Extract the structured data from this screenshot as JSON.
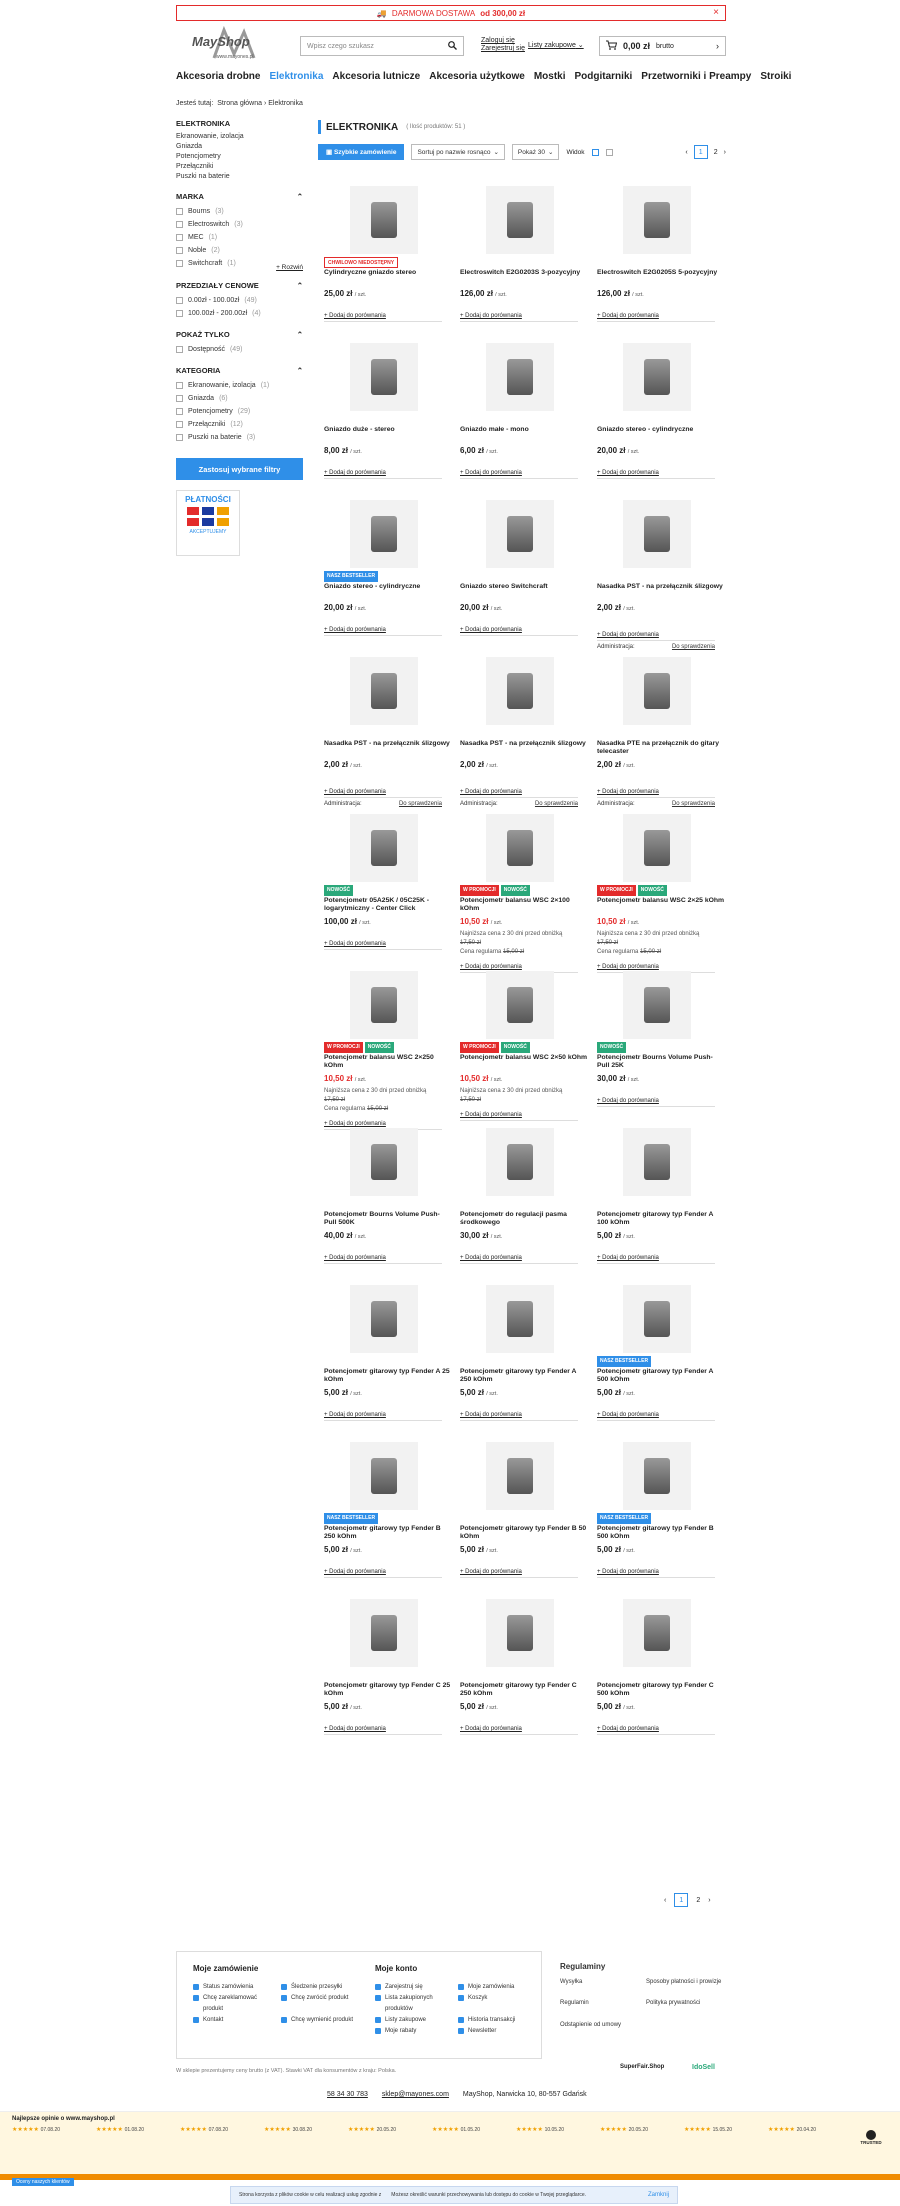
{
  "banner": {
    "text": "DARMOWA DOSTAWA",
    "amount": "od 300,00 zł"
  },
  "logo": {
    "name": "MayShop",
    "sub": "www.mayones.pl"
  },
  "search": {
    "placeholder": "Wpisz czego szukasz"
  },
  "account": {
    "login": "Zaloguj się",
    "register": "Zarejestruj się",
    "lists": "Listy zakupowe"
  },
  "cart": {
    "amount": "0,00 zł",
    "suffix": "brutto"
  },
  "nav": [
    "Akcesoria drobne",
    "Elektronika",
    "Akcesoria lutnicze",
    "Akcesoria użytkowe",
    "Mostki",
    "Podgitarniki",
    "Przetworniki i Preampy",
    "Stroiki"
  ],
  "breadcrumb": {
    "label": "Jesteś tutaj:",
    "home": "Strona główna",
    "current": "Elektronika"
  },
  "sidebar": {
    "cat_title": "ELEKTRONIKA",
    "cats": [
      "Ekranowanie, izolacja",
      "Gniazda",
      "Potencjometry",
      "Przełączniki",
      "Puszki na baterie"
    ],
    "brand_title": "MARKA",
    "brands": [
      {
        "n": "Bourns",
        "c": "(3)"
      },
      {
        "n": "Electroswitch",
        "c": "(3)"
      },
      {
        "n": "MEC",
        "c": "(1)"
      },
      {
        "n": "Noble",
        "c": "(2)"
      },
      {
        "n": "Switchcraft",
        "c": "(1)"
      }
    ],
    "expand": "+ Rozwiń",
    "price_title": "PRZEDZIAŁY CENOWE",
    "prices": [
      {
        "n": "0.00zł - 100.00zł",
        "c": "(49)"
      },
      {
        "n": "100.00zł - 200.00zł",
        "c": "(4)"
      }
    ],
    "show_title": "POKAŻ TYLKO",
    "shows": [
      {
        "n": "Dostępność",
        "c": "(49)"
      }
    ],
    "kat_title": "KATEGORIA",
    "kats": [
      {
        "n": "Ekranowanie, izolacja",
        "c": "(1)"
      },
      {
        "n": "Gniazda",
        "c": "(6)"
      },
      {
        "n": "Potencjometry",
        "c": "(29)"
      },
      {
        "n": "Przełączniki",
        "c": "(12)"
      },
      {
        "n": "Puszki na baterie",
        "c": "(3)"
      }
    ],
    "apply": "Zastosuj wybrane filtry",
    "payu_title": "PŁATNOŚCI",
    "payu_sub": "AKCEPTUJEMY"
  },
  "listing": {
    "title": "ELEKTRONIKA",
    "count": "( Ilość produktów: 51 )",
    "quick": "Szybkie zamówienie",
    "sort": "Sortuj po nazwie rosnąco",
    "perpage": "Pokaż 30",
    "view": "Widok"
  },
  "pager": {
    "prev": "‹",
    "p1": "1",
    "p2": "2",
    "next": "›"
  },
  "compare": "+ Dodaj do porównania",
  "admin": {
    "label": "Administracja:",
    "action": "Do sprawdzenia"
  },
  "price_unit": "/ szt.",
  "low_label": "Najniższa cena z 30 dni przed obniżką",
  "regular_label": "Cena regularna",
  "products": [
    {
      "name": "Cylindryczne gniazdo stereo",
      "price": "25,00 zł",
      "badges": [
        {
          "t": "CHWILOWO NIEDOSTĘPNY",
          "c": "redo"
        }
      ]
    },
    {
      "name": "Electroswitch E2G0203S 3-pozycyjny",
      "price": "126,00 zł",
      "badges": []
    },
    {
      "name": "Electroswitch E2G0205S 5-pozycyjny",
      "price": "126,00 zł",
      "badges": []
    },
    {
      "name": "Gniazdo duże - stereo",
      "price": "8,00 zł",
      "badges": []
    },
    {
      "name": "Gniazdo małe - mono",
      "price": "6,00 zł",
      "badges": []
    },
    {
      "name": "Gniazdo stereo - cylindryczne",
      "price": "20,00 zł",
      "badges": []
    },
    {
      "name": "Gniazdo stereo - cylindryczne",
      "price": "20,00 zł",
      "badges": [
        {
          "t": "NASZ BESTSELLER",
          "c": "blue"
        }
      ]
    },
    {
      "name": "Gniazdo stereo Switchcraft",
      "price": "20,00 zł",
      "badges": []
    },
    {
      "name": "Nasadka PST - na przełącznik ślizgowy",
      "price": "2,00 zł",
      "badges": [],
      "admin": true
    },
    {
      "name": "Nasadka PST - na przełącznik ślizgowy",
      "price": "2,00 zł",
      "badges": [],
      "admin": true
    },
    {
      "name": "Nasadka PST - na przełącznik ślizgowy",
      "price": "2,00 zł",
      "badges": [],
      "admin": true
    },
    {
      "name": "Nasadka PTE na przełącznik do gitary telecaster",
      "price": "2,00 zł",
      "badges": [],
      "admin": true
    },
    {
      "name": "Potencjometr 05A25K / 05C25K - logarytmiczny - Center Click",
      "price": "100,00 zł",
      "badges": [
        {
          "t": "NOWOŚĆ",
          "c": "green"
        }
      ]
    },
    {
      "name": "Potencjometr balansu WSC 2×100 kOhm",
      "price": "10,50 zł",
      "red": true,
      "low": "17,50 zł",
      "regular": "15,00 zł",
      "badges": [
        {
          "t": "W PROMOCJI",
          "c": "red"
        },
        {
          "t": "NOWOŚĆ",
          "c": "green"
        }
      ]
    },
    {
      "name": "Potencjometr balansu WSC 2×25 kOhm",
      "price": "10,50 zł",
      "red": true,
      "low": "17,50 zł",
      "regular": "15,00 zł",
      "badges": [
        {
          "t": "W PROMOCJI",
          "c": "red"
        },
        {
          "t": "NOWOŚĆ",
          "c": "green"
        }
      ]
    },
    {
      "name": "Potencjometr balansu WSC 2×250 kOhm",
      "price": "10,50 zł",
      "red": true,
      "low": "17,50 zł",
      "regular": "15,00 zł",
      "badges": [
        {
          "t": "W PROMOCJI",
          "c": "red"
        },
        {
          "t": "NOWOŚĆ",
          "c": "green"
        }
      ]
    },
    {
      "name": "Potencjometr balansu WSC 2×50 kOhm",
      "price": "10,50 zł",
      "red": true,
      "low": "17,50 zł",
      "badges": [
        {
          "t": "W PROMOCJI",
          "c": "red"
        },
        {
          "t": "NOWOŚĆ",
          "c": "green"
        }
      ]
    },
    {
      "name": "Potencjometr Bourns Volume Push-Pull 25K",
      "price": "30,00 zł",
      "badges": [
        {
          "t": "NOWOŚĆ",
          "c": "green"
        }
      ]
    },
    {
      "name": "Potencjometr Bourns Volume Push-Pull 500K",
      "price": "40,00 zł",
      "badges": []
    },
    {
      "name": "Potencjometr do regulacji pasma środkowego",
      "price": "30,00 zł",
      "badges": []
    },
    {
      "name": "Potencjometr gitarowy typ Fender A 100 kOhm",
      "price": "5,00 zł",
      "badges": []
    },
    {
      "name": "Potencjometr gitarowy typ Fender A 25 kOhm",
      "price": "5,00 zł",
      "badges": []
    },
    {
      "name": "Potencjometr gitarowy typ Fender A 250 kOhm",
      "price": "5,00 zł",
      "badges": []
    },
    {
      "name": "Potencjometr gitarowy typ Fender A 500 kOhm",
      "price": "5,00 zł",
      "badges": [
        {
          "t": "NASZ BESTSELLER",
          "c": "blue"
        }
      ]
    },
    {
      "name": "Potencjometr gitarowy typ Fender B 250 kOhm",
      "price": "5,00 zł",
      "badges": [
        {
          "t": "NASZ BESTSELLER",
          "c": "blue"
        }
      ]
    },
    {
      "name": "Potencjometr gitarowy typ Fender B 50 kOhm",
      "price": "5,00 zł",
      "badges": []
    },
    {
      "name": "Potencjometr gitarowy typ Fender B 500 kOhm",
      "price": "5,00 zł",
      "badges": [
        {
          "t": "NASZ BESTSELLER",
          "c": "blue"
        }
      ]
    },
    {
      "name": "Potencjometr gitarowy typ Fender C 25 kOhm",
      "price": "5,00 zł",
      "badges": []
    },
    {
      "name": "Potencjometr gitarowy typ Fender C 250 kOhm",
      "price": "5,00 zł",
      "badges": []
    },
    {
      "name": "Potencjometr gitarowy typ Fender C 500 kOhm",
      "price": "5,00 zł",
      "badges": []
    }
  ],
  "footer": {
    "orders_title": "Moje zamówienie",
    "orders": [
      "Status zamówienia",
      "Śledzenie przesyłki",
      "Chcę zareklamować produkt",
      "Chcę zwrócić produkt",
      "Kontakt",
      "Chcę wymienić produkt"
    ],
    "account_title": "Moje konto",
    "account": [
      "Zarejestruj się",
      "Moje zamówienia",
      "Lista zakupionych produktów",
      "Koszyk",
      "Listy zakupowe",
      "Historia transakcji",
      "Moje rabaty",
      "Newsletter"
    ],
    "rules_title": "Regulaminy",
    "rules": [
      "Wysyłka",
      "Sposoby płatności i prowizje",
      "Regulamin",
      "Polityka prywatności",
      "Odstąpienie od umowy"
    ],
    "vat": "W sklepie prezentujemy ceny brutto (z VAT). Stawki VAT dla konsumentów z kraju: Polska.",
    "superfair": "SuperFair.Shop",
    "idosell": "IdoSell",
    "phone": "58 34 30 783",
    "email": "sklep@mayones.com",
    "address": "MayShop, Narwicka 10, 80-557 Gdańsk"
  },
  "opinions": {
    "title": "Najlepsze opinie o www.mayshop.pl",
    "dates": [
      "07.08.20",
      "01.08.20",
      "07.08.20",
      "30.08.20",
      "20.05.20",
      "01.05.20",
      "10.05.20",
      "20.05.20",
      "15.05.20",
      "20.04.20"
    ],
    "trusted": "TRUSTED"
  },
  "side_tab": "Oceny naszych klientów",
  "cookie": {
    "text": "Strona korzysta z plików cookie w celu realizacji usług zgodnie z",
    "text2": "Możesz określić warunki przechowywania lub dostępu do cookie w Twojej przeglądarce.",
    "accept": "Zamknij"
  },
  "colors": {
    "accent": "#2f8fe8",
    "promo": "#e32b2b",
    "new": "#2aa87a"
  }
}
